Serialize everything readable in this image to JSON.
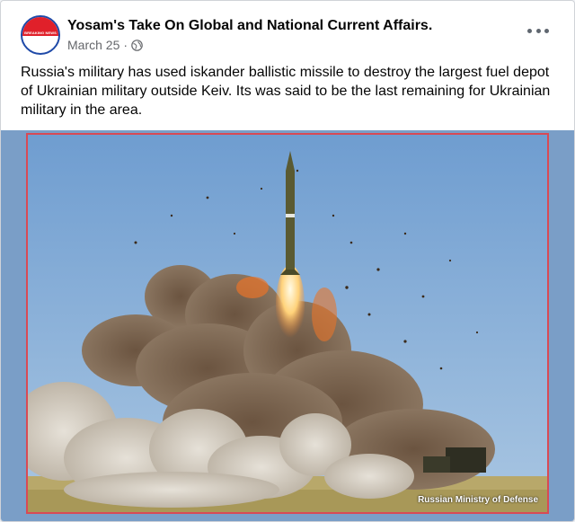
{
  "post": {
    "page_name": "Yosam's Take On Global and National Current Affairs.",
    "date": "March 25",
    "separator": "·",
    "privacy_icon": "globe-icon",
    "more_icon": "more-options-icon",
    "caption": "Russia's military has used iskander ballistic missile to destroy the largest fuel depot of Ukrainian military outside Keiv. Its was said to be the last remaining for Ukrainian military in the area.",
    "avatar_text": "BREAKING NEWS"
  },
  "image": {
    "credit": "Russian Ministry of Defense",
    "sky_color": "#7fa6d2",
    "smoke_color": "#7a6450",
    "flame_color": "#ffd27a"
  }
}
